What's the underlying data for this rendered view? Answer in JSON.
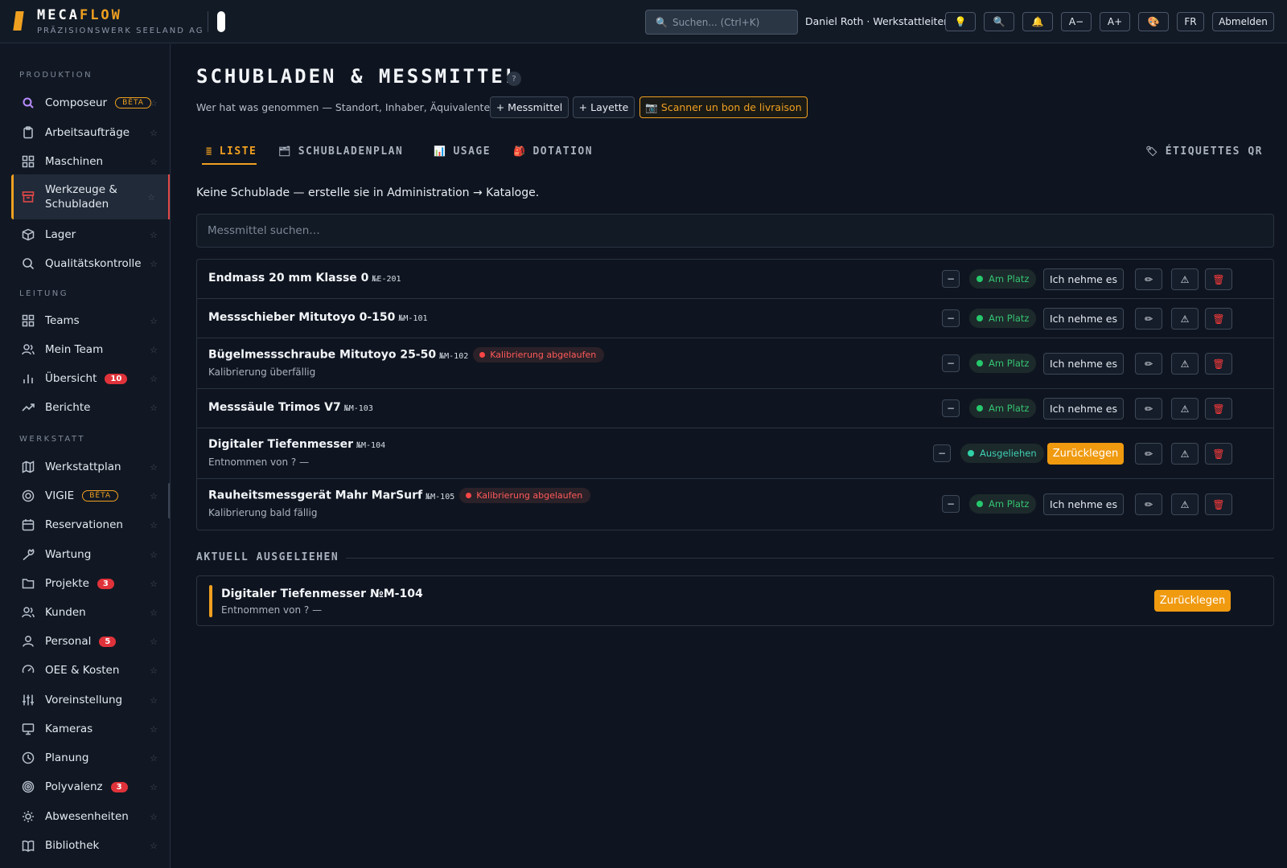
{
  "brand": {
    "name_a": "MECA",
    "name_b": "FLOW",
    "company": "PRÄZISIONSWERK SEELAND AG"
  },
  "topbar": {
    "search_placeholder": "Suchen...  (Ctrl+K)",
    "user": "Daniel Roth · Werkstattleiter",
    "buttons": {
      "tip": "💡",
      "find": "🔍",
      "bell": "🔔",
      "font_down": "A−",
      "font_up": "A+",
      "theme": "🎨",
      "lang": "FR",
      "logout": "Abmelden"
    }
  },
  "sidebar": {
    "sections": {
      "produktion": "PRODUKTION",
      "leitung": "LEITUNG",
      "werkstatt": "WERKSTATT"
    },
    "star": "☆",
    "items": [
      {
        "label": "Composeur",
        "badge": "BÊTA"
      },
      {
        "label": "Arbeitsaufträge"
      },
      {
        "label": "Maschinen"
      },
      {
        "label": "Werkzeuge & Schubladen",
        "active": true
      },
      {
        "label": "Lager"
      },
      {
        "label": "Qualitätskontrolle"
      },
      {
        "label": "Teams"
      },
      {
        "label": "Mein Team"
      },
      {
        "label": "Übersicht",
        "count": "10"
      },
      {
        "label": "Berichte"
      },
      {
        "label": "Werkstattplan"
      },
      {
        "label": "VIGIE",
        "badge": "BÊTA"
      },
      {
        "label": "Reservationen"
      },
      {
        "label": "Wartung"
      },
      {
        "label": "Projekte",
        "count": "3"
      },
      {
        "label": "Kunden"
      },
      {
        "label": "Personal",
        "count": "5"
      },
      {
        "label": "OEE & Kosten"
      },
      {
        "label": "Voreinstellung"
      },
      {
        "label": "Kameras"
      },
      {
        "label": "Planung"
      },
      {
        "label": "Polyvalenz",
        "count": "3"
      },
      {
        "label": "Abwesenheiten"
      },
      {
        "label": "Bibliothek"
      }
    ]
  },
  "page": {
    "title": "SCHUBLADEN & MESSMITTEL",
    "help": "?",
    "subtitle": "Wer hat was genommen — Standort, Inhaber, Äquivalente.",
    "actions": {
      "add_instrument": "+ Messmittel",
      "add_layette": "+ Layette",
      "scan": "📷 Scanner un bon de livraison"
    },
    "tabs": [
      {
        "icon": "≣",
        "label": "LISTE",
        "active": true
      },
      {
        "icon": "🗂",
        "label": "SCHUBLADENPLAN"
      },
      {
        "icon": "📊",
        "label": "USAGE"
      },
      {
        "icon": "🎒",
        "label": "DOTATION"
      }
    ],
    "qr_tab": {
      "icon": "🏷",
      "label": "ÉTIQUETTES QR"
    },
    "empty_note": "Keine Schublade — erstelle sie in Administration → Kataloge.",
    "search_placeholder": "Messmittel suchen…"
  },
  "row_actions": {
    "minus": "−",
    "take": "Ich nehme es",
    "return": "Zurücklegen",
    "edit": "✏",
    "warn": "⚠",
    "delete": "🗑"
  },
  "instruments": [
    {
      "name": "Endmass 20 mm Klasse 0",
      "code": "№E-201",
      "status": "Am Platz"
    },
    {
      "name": "Messschieber Mitutoyo 0-150",
      "code": "№M-101",
      "status": "Am Platz"
    },
    {
      "name": "Bügelmessschraube Mitutoyo 25-50",
      "code": "№M-102",
      "calibration": "Kalibrierung abgelaufen",
      "note": "Kalibrierung überfällig",
      "status": "Am Platz"
    },
    {
      "name": "Messsäule Trimos V7",
      "code": "№M-103",
      "status": "Am Platz"
    },
    {
      "name": "Digitaler Tiefenmesser",
      "code": "№M-104",
      "note": "Entnommen von ? —",
      "status": "Ausgeliehen"
    },
    {
      "name": "Rauheitsmessgerät Mahr MarSurf",
      "code": "№M-105",
      "calibration": "Kalibrierung abgelaufen",
      "note": "Kalibrierung bald fällig",
      "status": "Am Platz"
    }
  ],
  "loans": {
    "heading": "AKTUELL AUSGELIEHEN",
    "items": [
      {
        "name": "Digitaler Tiefenmesser №M-104",
        "note": "Entnommen von ? —",
        "button": "Zurücklegen"
      }
    ]
  }
}
